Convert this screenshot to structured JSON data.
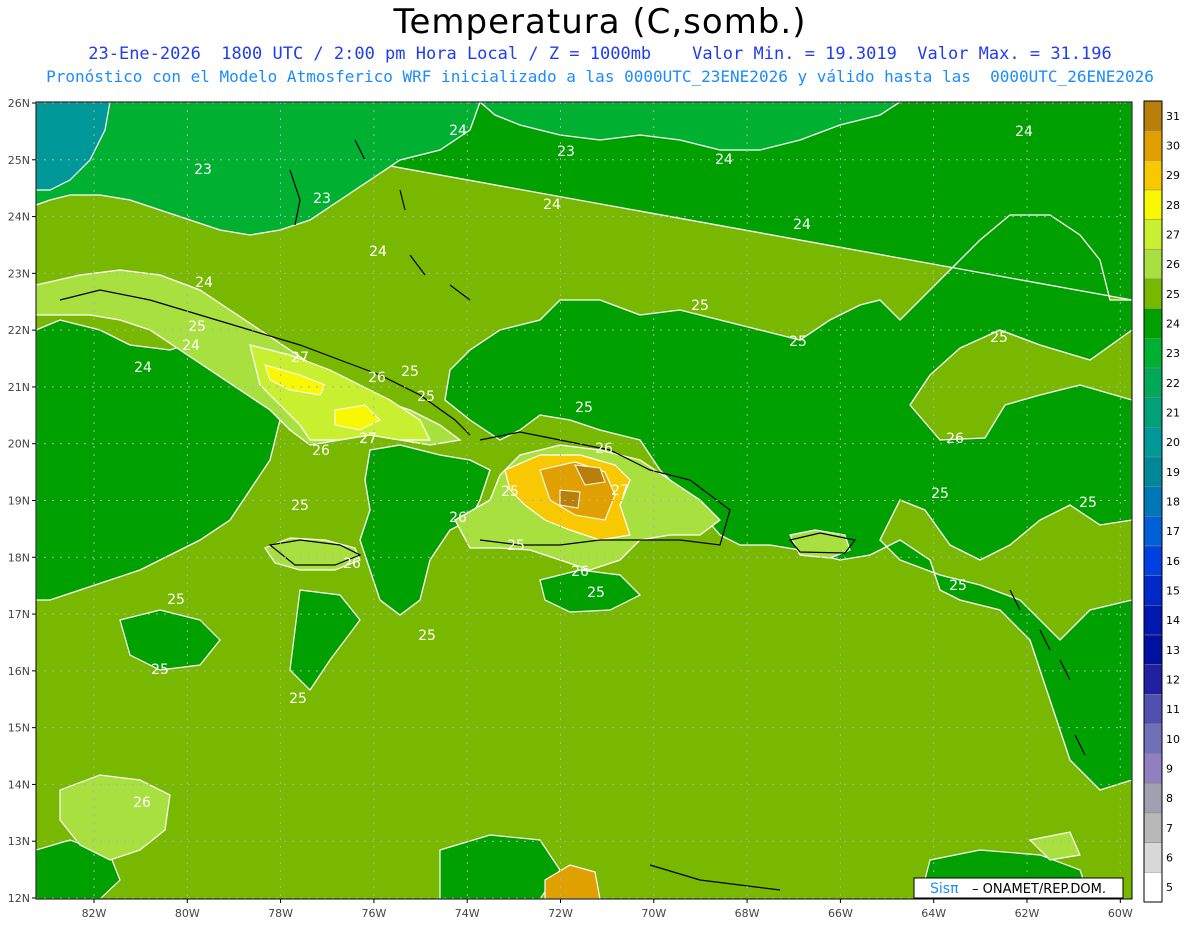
{
  "header": {
    "title": "Temperatura (C,somb.)",
    "line1": "23-Ene-2026  1800 UTC / 2:00 pm Hora Local / Z = 1000mb    Valor Min. = 19.3019  Valor Max. = 31.196",
    "line2": "Pronóstico con el Modelo Atmosferico WRF inicializado a las 0000UTC_23ENE2026 y válido hasta las  0000UTC_26ENE2026"
  },
  "axes": {
    "lat_labels": [
      "26N",
      "25N",
      "24N",
      "23N",
      "22N",
      "21N",
      "20N",
      "19N",
      "18N",
      "17N",
      "16N",
      "15N",
      "14N",
      "13N",
      "12N"
    ],
    "lon_labels": [
      "82W",
      "80W",
      "78W",
      "76W",
      "74W",
      "72W",
      "70W",
      "68W",
      "66W",
      "64W",
      "62W",
      "60W"
    ]
  },
  "colorbar": {
    "labels": [
      "31",
      "30",
      "29",
      "28",
      "27",
      "26",
      "25",
      "24",
      "23",
      "22",
      "21",
      "20",
      "19",
      "18",
      "17",
      "16",
      "15",
      "14",
      "13",
      "12",
      "11",
      "10",
      "9",
      "8",
      "7",
      "6",
      "5"
    ],
    "colors": [
      "#b8800a",
      "#e0a000",
      "#f8c800",
      "#f8f800",
      "#c8f030",
      "#a8e040",
      "#78b800",
      "#00a000",
      "#00b030",
      "#00a858",
      "#00a078",
      "#009898",
      "#008898",
      "#0078b8",
      "#0060d8",
      "#0040e0",
      "#0028c8",
      "#0018b0",
      "#0010a0",
      "#2020a0",
      "#5050b0",
      "#7070b8",
      "#9080c0",
      "#a0a0b0",
      "#b8b8b8",
      "#d8d8d8",
      "#ffffff"
    ]
  },
  "contour_labels": [
    {
      "text": "24"
    },
    {
      "text": "23"
    },
    {
      "text": "24"
    },
    {
      "text": "24"
    },
    {
      "text": "23"
    },
    {
      "text": "23"
    },
    {
      "text": "24"
    },
    {
      "text": "24"
    },
    {
      "text": "24"
    },
    {
      "text": "25"
    },
    {
      "text": "24"
    },
    {
      "text": "25"
    },
    {
      "text": "24"
    },
    {
      "text": "24"
    },
    {
      "text": "27"
    },
    {
      "text": "26"
    },
    {
      "text": "25"
    },
    {
      "text": "25"
    },
    {
      "text": "27"
    },
    {
      "text": "26"
    },
    {
      "text": "25"
    },
    {
      "text": "25"
    },
    {
      "text": "25"
    },
    {
      "text": "25"
    },
    {
      "text": "26"
    },
    {
      "text": "25"
    },
    {
      "text": "27"
    },
    {
      "text": "26"
    },
    {
      "text": "25"
    },
    {
      "text": "26"
    },
    {
      "text": "26"
    },
    {
      "text": "25"
    },
    {
      "text": "25"
    },
    {
      "text": "25"
    },
    {
      "text": "25"
    },
    {
      "text": "25"
    },
    {
      "text": "25"
    },
    {
      "text": "25"
    },
    {
      "text": "26"
    },
    {
      "text": "25"
    },
    {
      "text": "26"
    }
  ],
  "credits": {
    "logo": "Sisπ",
    "text": "– ONAMET/REP.DOM."
  },
  "colors": {
    "title_blue": "#1f3df0",
    "subtitle_blue": "#1a8cff",
    "base_green": "#78b800",
    "grid": "#b0b0b0"
  }
}
